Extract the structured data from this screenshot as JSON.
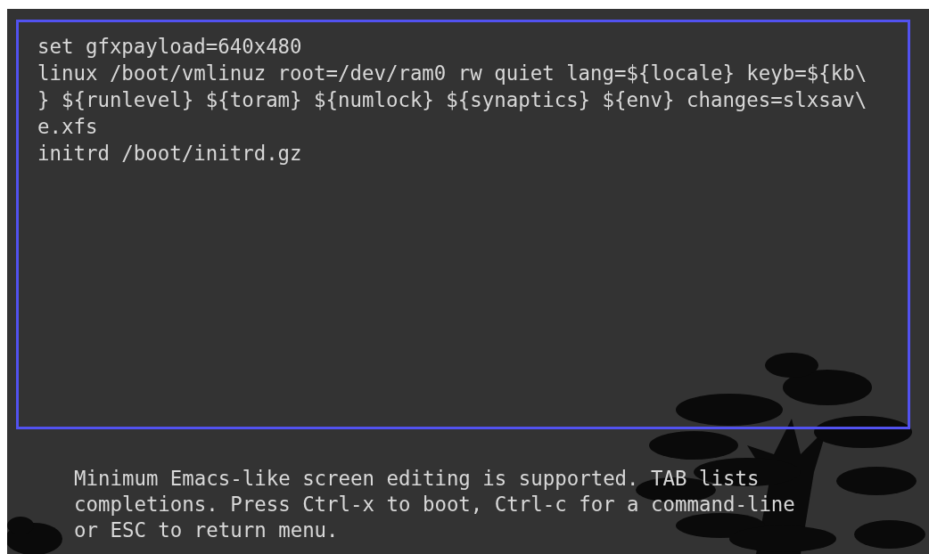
{
  "editor": {
    "lines": [
      "set gfxpayload=640x480",
      "linux /boot/vmlinuz root=/dev/ram0 rw quiet lang=${locale} keyb=${kb\\",
      "} ${runlevel} ${toram} ${numlock} ${synaptics} ${env} changes=slxsav\\",
      "e.xfs",
      "initrd /boot/initrd.gz"
    ]
  },
  "help_text": [
    "Minimum Emacs-like screen editing is supported. TAB lists",
    "completions. Press Ctrl-x to boot, Ctrl-c for a command-line",
    "or ESC to return menu."
  ]
}
